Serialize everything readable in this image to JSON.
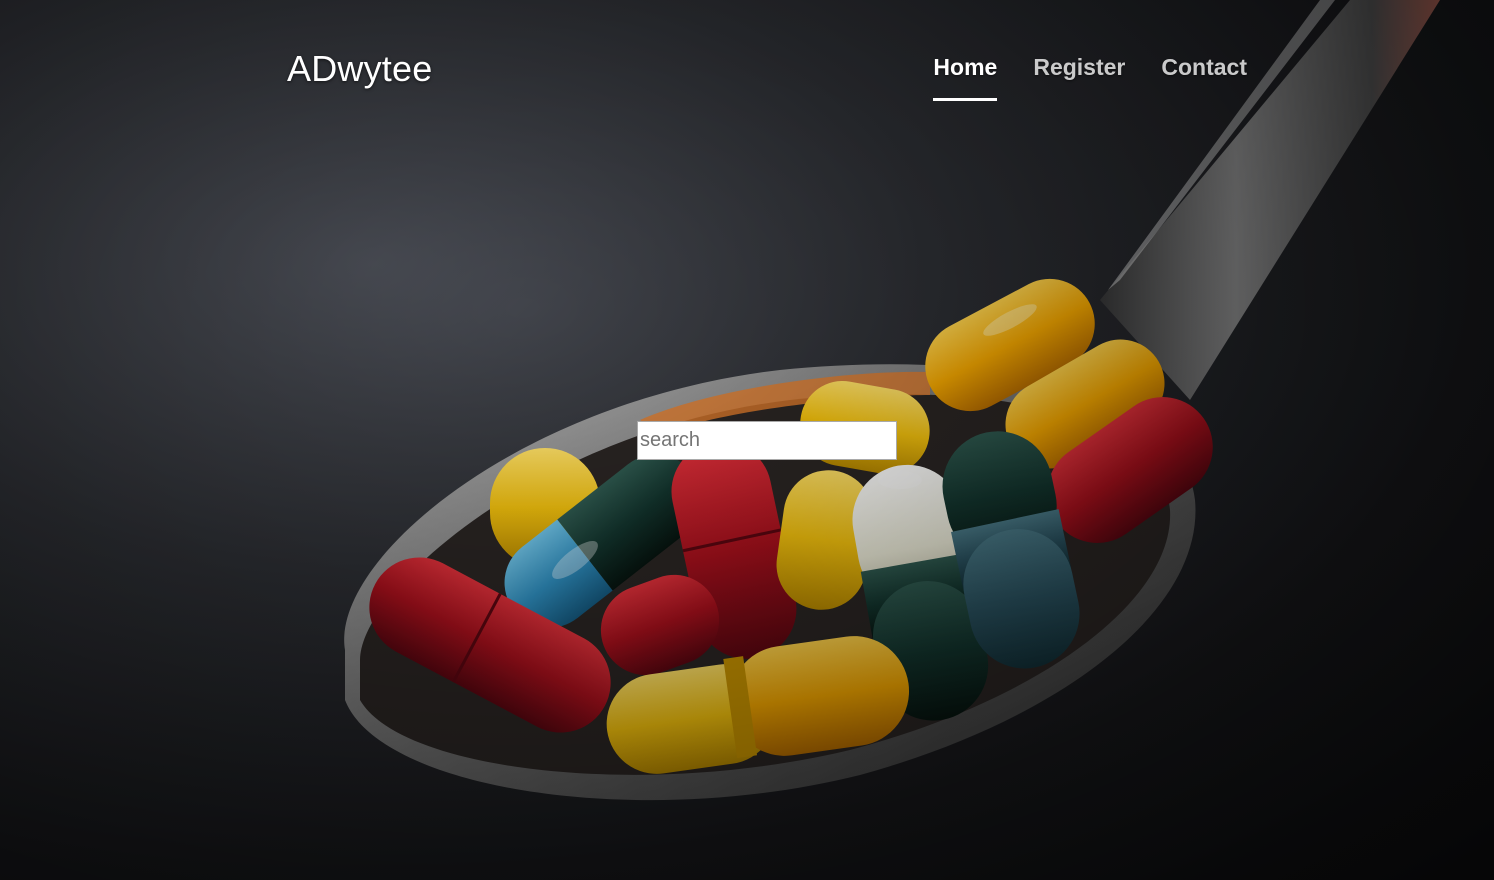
{
  "header": {
    "brand": "ADwytee",
    "nav": [
      {
        "label": "Home",
        "active": true
      },
      {
        "label": "Register",
        "active": false
      },
      {
        "label": "Contact",
        "active": false
      }
    ]
  },
  "hero": {
    "image_subject": "spoon-full-of-pills-photo",
    "search": {
      "placeholder": "search",
      "value": ""
    }
  }
}
